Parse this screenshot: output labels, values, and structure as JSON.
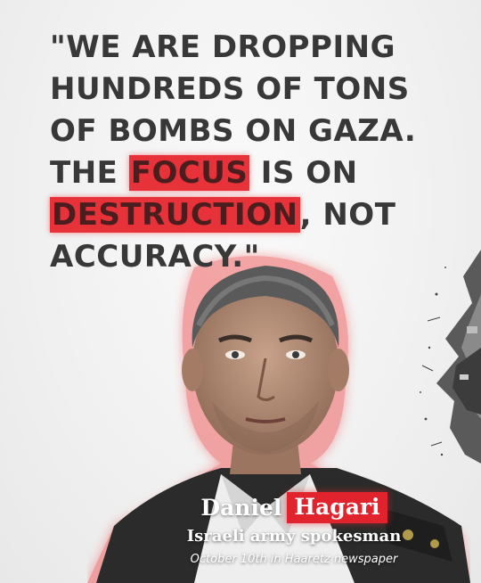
{
  "quote": {
    "line1": "\"WE ARE DROPPING",
    "line2": "HUNDREDS OF TONS",
    "line3": "OF BOMBS ON GAZA.",
    "line4_pre": "THE ",
    "line4_hl": "FOCUS",
    "line4_post": " IS ON",
    "line5_hl": "DESTRUCTION",
    "line5_post": ", NOT",
    "line6": "ACCURACY.\""
  },
  "caption": {
    "first_name": "Daniel",
    "last_name": "Hagari",
    "role": "Israeli army spokesman",
    "source": "October 10th in Haaretz newspaper"
  },
  "colors": {
    "highlight": "#e8323a",
    "name_badge": "#e0232c",
    "quote_text": "#383838"
  },
  "icons": {
    "portrait": "man-portrait",
    "rubble": "rubble-collage"
  }
}
